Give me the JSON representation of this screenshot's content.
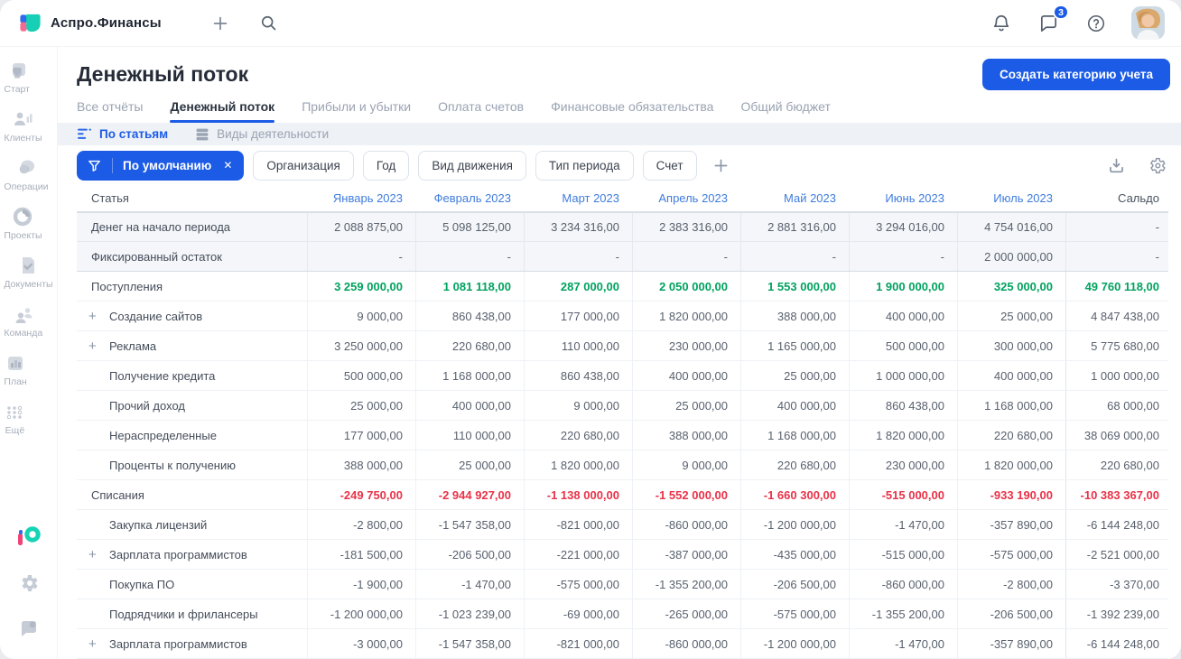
{
  "topbar": {
    "brand": "Аспро.Финансы",
    "chat_badge": "3"
  },
  "sidebar": {
    "items": [
      {
        "name": "start",
        "label": "Старт"
      },
      {
        "name": "clients",
        "label": "Клиенты"
      },
      {
        "name": "operations",
        "label": "Операции"
      },
      {
        "name": "projects",
        "label": "Проекты"
      },
      {
        "name": "documents",
        "label": "Документы"
      },
      {
        "name": "team",
        "label": "Команда"
      },
      {
        "name": "plan",
        "label": "План"
      },
      {
        "name": "more",
        "label": "Ещё"
      }
    ]
  },
  "header": {
    "title": "Денежный поток",
    "create_button": "Создать категорию учета",
    "tabs": [
      {
        "label": "Все отчёты",
        "active": false
      },
      {
        "label": "Денежный поток",
        "active": true
      },
      {
        "label": "Прибыли и убытки",
        "active": false
      },
      {
        "label": "Оплата счетов",
        "active": false
      },
      {
        "label": "Финансовые обязательства",
        "active": false
      },
      {
        "label": "Общий бюджет",
        "active": false
      }
    ]
  },
  "subtabs": [
    {
      "name": "by-articles",
      "label": "По статьям",
      "active": true
    },
    {
      "name": "activity-kinds",
      "label": "Виды деятельности",
      "active": false
    }
  ],
  "filters": {
    "active_filter": "По умолчанию",
    "buttons": [
      "Организация",
      "Год",
      "Вид движения",
      "Тип периода",
      "Счет"
    ]
  },
  "table": {
    "first_column": "Статья",
    "months": [
      "Январь 2023",
      "Февраль 2023",
      "Март 2023",
      "Апрель 2023",
      "Май 2023",
      "Июнь 2023",
      "Июль 2023"
    ],
    "last_column": "Сальдо",
    "rows": [
      {
        "label": "Денег на начало периода",
        "type": "summary",
        "expandable": false,
        "values": [
          "2 088 875,00",
          "5 098 125,00",
          "3 234 316,00",
          "2 383 316,00",
          "2 881 316,00",
          "3 294 016,00",
          "4 754 016,00",
          "-"
        ]
      },
      {
        "label": "Фиксированный остаток",
        "type": "summary last",
        "expandable": false,
        "values": [
          "-",
          "-",
          "-",
          "-",
          "-",
          "-",
          "2 000 000,00",
          "-"
        ]
      },
      {
        "label": "Поступления",
        "type": "inflow-total",
        "expandable": false,
        "values": [
          "3 259 000,00",
          "1 081 118,00",
          "287 000,00",
          "2 050 000,00",
          "1 553 000,00",
          "1 900 000,00",
          "325 000,00",
          "49 760 118,00"
        ]
      },
      {
        "label": "Создание сайтов",
        "type": "item",
        "expandable": true,
        "values": [
          "9 000,00",
          "860 438,00",
          "177 000,00",
          "1 820 000,00",
          "388 000,00",
          "400 000,00",
          "25 000,00",
          "4 847 438,00"
        ]
      },
      {
        "label": "Реклама",
        "type": "item",
        "expandable": true,
        "values": [
          "3 250 000,00",
          "220 680,00",
          "110 000,00",
          "230 000,00",
          "1 165 000,00",
          "500 000,00",
          "300 000,00",
          "5 775 680,00"
        ]
      },
      {
        "label": "Получение кредита",
        "type": "item",
        "expandable": false,
        "values": [
          "500 000,00",
          "1 168 000,00",
          "860 438,00",
          "400 000,00",
          "25 000,00",
          "1 000 000,00",
          "400 000,00",
          "1 000 000,00"
        ]
      },
      {
        "label": "Прочий доход",
        "type": "item",
        "expandable": false,
        "values": [
          "25 000,00",
          "400 000,00",
          "9 000,00",
          "25 000,00",
          "400 000,00",
          "860 438,00",
          "1 168 000,00",
          "68 000,00"
        ]
      },
      {
        "label": "Нераспределенные",
        "type": "item",
        "expandable": false,
        "values": [
          "177 000,00",
          "110 000,00",
          "220 680,00",
          "388 000,00",
          "1 168 000,00",
          "1 820 000,00",
          "220 680,00",
          "38 069 000,00"
        ]
      },
      {
        "label": "Проценты к получению",
        "type": "item",
        "expandable": false,
        "values": [
          "388 000,00",
          "25 000,00",
          "1 820 000,00",
          "9 000,00",
          "220 680,00",
          "230 000,00",
          "1 820 000,00",
          "220 680,00"
        ]
      },
      {
        "label": "Списания",
        "type": "outflow-total",
        "expandable": false,
        "values": [
          "-249 750,00",
          "-2 944 927,00",
          "-1 138 000,00",
          "-1 552 000,00",
          "-1 660 300,00",
          "-515 000,00",
          "-933 190,00",
          "-10 383 367,00"
        ]
      },
      {
        "label": "Закупка лицензий",
        "type": "item",
        "expandable": false,
        "values": [
          "-2 800,00",
          "-1 547 358,00",
          "-821 000,00",
          "-860 000,00",
          "-1 200 000,00",
          "-1 470,00",
          "-357 890,00",
          "-6 144 248,00"
        ]
      },
      {
        "label": "Зарплата программистов",
        "type": "item",
        "expandable": true,
        "values": [
          "-181 500,00",
          "-206 500,00",
          "-221 000,00",
          "-387 000,00",
          "-435 000,00",
          "-515 000,00",
          "-575 000,00",
          "-2 521 000,00"
        ]
      },
      {
        "label": "Покупка ПО",
        "type": "item",
        "expandable": false,
        "values": [
          "-1 900,00",
          "-1 470,00",
          "-575 000,00",
          "-1 355 200,00",
          "-206 500,00",
          "-860 000,00",
          "-2 800,00",
          "-3 370,00"
        ]
      },
      {
        "label": "Подрядчики и фрилансеры",
        "type": "item",
        "expandable": false,
        "values": [
          "-1 200 000,00",
          "-1 023 239,00",
          "-69 000,00",
          "-265 000,00",
          "-575 000,00",
          "-1 355 200,00",
          "-206 500,00",
          "-1 392 239,00"
        ]
      },
      {
        "label": "Зарплата программистов",
        "type": "item",
        "expandable": true,
        "values": [
          "-3 000,00",
          "-1 547 358,00",
          "-821 000,00",
          "-860 000,00",
          "-1 200 000,00",
          "-1 470,00",
          "-357 890,00",
          "-6 144 248,00"
        ]
      }
    ]
  },
  "colors": {
    "accent_blue": "#1b5be6",
    "positive_green": "#00a25f",
    "negative_red": "#e93248",
    "month_link_blue": "#3f7cdd"
  }
}
